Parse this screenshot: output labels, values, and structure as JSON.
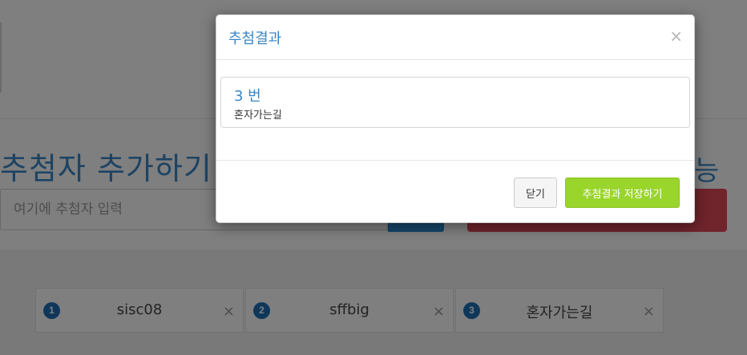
{
  "page": {
    "section_title": "추첨자 추가하기",
    "section_title_right": "능",
    "add_input": {
      "placeholder": "여기에 추첨자 입력",
      "value": ""
    },
    "entries": [
      {
        "number": "1",
        "name": "sisc08",
        "remove": "×"
      },
      {
        "number": "2",
        "name": "sffbig",
        "remove": "×"
      },
      {
        "number": "3",
        "name": "혼자가는길",
        "remove": "×"
      }
    ]
  },
  "modal": {
    "title": "추첨결과",
    "close_symbol": "×",
    "result": {
      "number_label": "3 번",
      "name": "혼자가는길"
    },
    "footer": {
      "close_label": "닫기",
      "save_label": "추첨결과 저장하기"
    }
  },
  "colors": {
    "accent_blue": "#3a86c6",
    "badge_blue": "#1e6fb5",
    "add_button": "#2d8bd0",
    "draw_button": "#e04858",
    "save_button": "#9ad52c"
  }
}
